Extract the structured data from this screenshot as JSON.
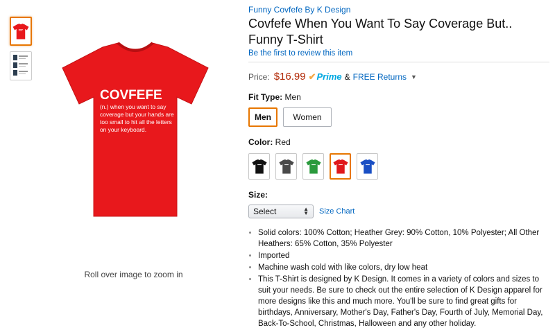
{
  "brand": "Funny Covfefe By K Design",
  "title": "Covfefe When You Want To Say Coverage But.. Funny T-Shirt",
  "review_link": "Be the first to review this item",
  "price": {
    "label": "Price:",
    "amount": "$16.99",
    "prime_label": "Prime",
    "and": "&",
    "free_returns": "FREE Returns"
  },
  "fit_type": {
    "label": "Fit Type:",
    "value": "Men",
    "options": [
      "Men",
      "Women"
    ]
  },
  "color": {
    "label": "Color:",
    "value": "Red",
    "swatches": [
      {
        "name": "Black",
        "hex": "#111111"
      },
      {
        "name": "Dark Heather",
        "hex": "#4a4a4a"
      },
      {
        "name": "Kelly Green",
        "hex": "#2a9a3c"
      },
      {
        "name": "Red",
        "hex": "#e0181c"
      },
      {
        "name": "Royal Blue",
        "hex": "#1a4fc4"
      }
    ]
  },
  "size": {
    "label": "Size:",
    "select_value": "Select",
    "size_chart": "Size Chart"
  },
  "bullets": [
    "Solid colors: 100% Cotton; Heather Grey: 90% Cotton, 10% Polyester; All Other Heathers: 65% Cotton, 35% Polyester",
    "Imported",
    "Machine wash cold with like colors, dry low heat",
    "This T-Shirt is designed by K Design. It comes in a variety of colors and sizes to suit your needs. Be sure to check out the entire selection of K Design apparel for more designs like this and much more. You'll be sure to find great gifts for birthdays, Anniversary, Mother's Day, Father's Day, Fourth of July, Memorial Day, Back-To-School, Christmas, Halloween and any other holiday."
  ],
  "zoom_hint": "Roll over image to zoom in",
  "shirt": {
    "color": "#e8181c",
    "headline": "COVFEFE",
    "lines": [
      "(n.) when you want to say",
      "coverage but your hands are",
      "too small to hit all the letters",
      "on your keyboard."
    ]
  }
}
